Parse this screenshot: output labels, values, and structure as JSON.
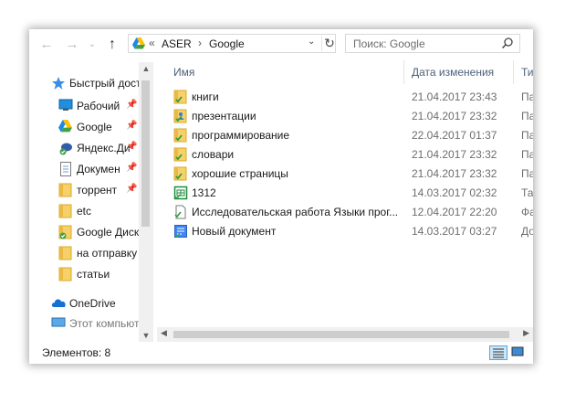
{
  "nav": {
    "back": "←",
    "forward": "→",
    "recent": "⌄",
    "up": "↑"
  },
  "address": {
    "overflow": "«",
    "segments": [
      "ASER",
      "Google"
    ],
    "separator": "›",
    "dropdown": "⌄",
    "refresh": "↻"
  },
  "search": {
    "placeholder": "Поиск: Google"
  },
  "navpane": {
    "items": [
      {
        "label": "Быстрый дост",
        "icon": "star-icon",
        "pinned": false
      },
      {
        "label": "Рабочий",
        "icon": "desktop-icon",
        "pinned": true
      },
      {
        "label": "Google",
        "icon": "google-drive-icon",
        "pinned": true
      },
      {
        "label": "Яндекс.Ди",
        "icon": "yandex-disk-icon",
        "pinned": true
      },
      {
        "label": "Докумен",
        "icon": "documents-icon",
        "pinned": true
      },
      {
        "label": "торрент",
        "icon": "folder-icon",
        "pinned": true
      },
      {
        "label": "etc",
        "icon": "folder-icon",
        "pinned": false
      },
      {
        "label": "Google Диск",
        "icon": "google-disk-folder-icon",
        "pinned": false
      },
      {
        "label": "на отправку",
        "icon": "folder-icon",
        "pinned": false
      },
      {
        "label": "статьи",
        "icon": "folder-icon",
        "pinned": false
      },
      {
        "label": "OneDrive",
        "icon": "onedrive-icon",
        "pinned": false
      },
      {
        "label": "Этот компьют",
        "icon": "computer-icon",
        "pinned": false
      }
    ],
    "pin_glyph": "📌"
  },
  "columns": {
    "name": "Имя",
    "date": "Дата изменения",
    "type": "Ти"
  },
  "files": [
    {
      "name": "книги",
      "date": "21.04.2017 23:43",
      "type": "Па",
      "icon": "synced-folder-icon"
    },
    {
      "name": "презентации",
      "date": "21.04.2017 23:32",
      "type": "Па",
      "icon": "shared-folder-icon"
    },
    {
      "name": "программирование",
      "date": "22.04.2017 01:37",
      "type": "Па",
      "icon": "synced-folder-icon"
    },
    {
      "name": "словари",
      "date": "21.04.2017 23:32",
      "type": "Па",
      "icon": "synced-folder-icon"
    },
    {
      "name": "хорошие страницы",
      "date": "21.04.2017 23:32",
      "type": "Па",
      "icon": "synced-folder-icon"
    },
    {
      "name": "1312",
      "date": "14.03.2017 02:32",
      "type": "Та",
      "icon": "google-sheets-icon"
    },
    {
      "name": "Исследовательская работа Языки прог...",
      "date": "12.04.2017 22:20",
      "type": "Фа",
      "icon": "file-icon"
    },
    {
      "name": "Новый документ",
      "date": "14.03.2017 03:27",
      "type": "До",
      "icon": "google-docs-icon"
    }
  ],
  "status": {
    "count_text": "Элементов: 8"
  }
}
